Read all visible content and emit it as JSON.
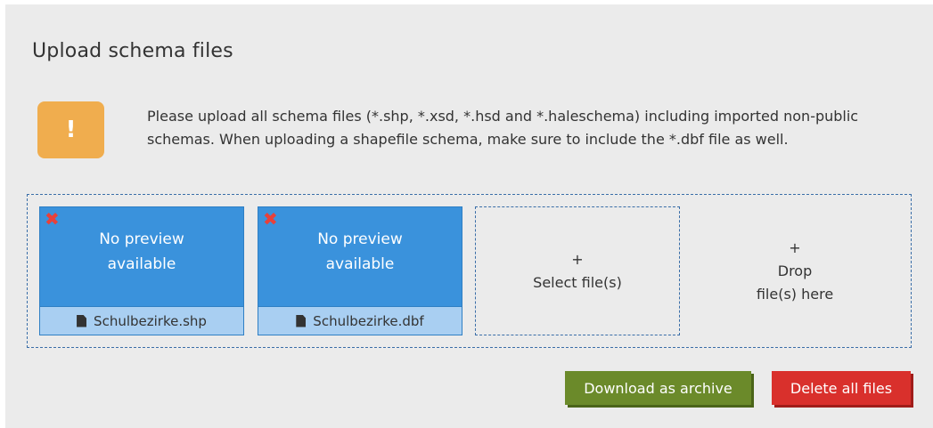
{
  "panel": {
    "title": "Upload schema files"
  },
  "notice": {
    "icon": "exclamation-icon",
    "icon_glyph": "!",
    "text": "Please upload all schema files (*.shp, *.xsd, *.hsd and *.haleschema) including imported non-public schemas. When uploading a shapefile schema, make sure to include the *.dbf file as well."
  },
  "files": [
    {
      "remove_glyph": "✖",
      "preview_line1": "No preview",
      "preview_line2": "available",
      "name": "Schulbezirke.shp"
    },
    {
      "remove_glyph": "✖",
      "preview_line1": "No preview",
      "preview_line2": "available",
      "name": "Schulbezirke.dbf"
    }
  ],
  "select": {
    "plus": "+",
    "label": "Select file(s)"
  },
  "drop": {
    "plus": "+",
    "line1": "Drop",
    "line2": "file(s) here"
  },
  "actions": {
    "download_label": "Download as archive",
    "delete_label": "Delete all files"
  },
  "colors": {
    "tile_blue": "#3a92dc",
    "filename_bar": "#a9cff2",
    "warning": "#f0ad4e",
    "download_green": "#6b8a2a",
    "delete_red": "#d9302c"
  }
}
